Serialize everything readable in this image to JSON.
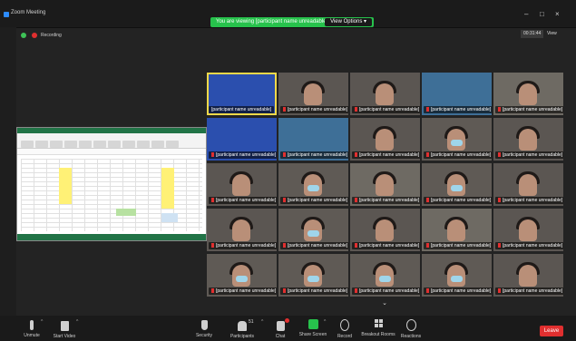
{
  "window": {
    "title": "Zoom Meeting",
    "controls": {
      "minimize": "–",
      "maximize": "□",
      "close": "×"
    }
  },
  "banner": {
    "text": "You are viewing [participant name unreadable]'s screen",
    "view_options": "View Options ▾",
    "color": "#27c24c"
  },
  "top": {
    "recording_label": "Recording",
    "timer": "00:31:44",
    "view_label": "View"
  },
  "shared_screen": {
    "app": "spreadsheet"
  },
  "participants": [
    {
      "name": "[participant name unreadable]",
      "muted": false,
      "active": true,
      "kind": "slide"
    },
    {
      "name": "[participant name unreadable]",
      "muted": true,
      "kind": "person"
    },
    {
      "name": "[participant name unreadable]",
      "muted": true,
      "kind": "person"
    },
    {
      "name": "[participant name unreadable]",
      "muted": true,
      "kind": "scenery"
    },
    {
      "name": "[participant name unreadable]",
      "muted": true,
      "kind": "room"
    },
    {
      "name": "[participant name unreadable]",
      "muted": true,
      "kind": "slide"
    },
    {
      "name": "[participant name unreadable]",
      "muted": true,
      "kind": "scenery"
    },
    {
      "name": "[participant name unreadable]",
      "muted": true,
      "kind": "person"
    },
    {
      "name": "[participant name unreadable]",
      "muted": true,
      "kind": "person-mask"
    },
    {
      "name": "[participant name unreadable]",
      "muted": true,
      "kind": "person"
    },
    {
      "name": "[participant name unreadable]",
      "muted": true,
      "kind": "person"
    },
    {
      "name": "[participant name unreadable]",
      "muted": true,
      "kind": "person-mask"
    },
    {
      "name": "[participant name unreadable]",
      "muted": true,
      "kind": "room"
    },
    {
      "name": "[participant name unreadable]",
      "muted": true,
      "kind": "person-mask"
    },
    {
      "name": "[participant name unreadable]",
      "muted": true,
      "kind": "person"
    },
    {
      "name": "[participant name unreadable]",
      "muted": true,
      "kind": "person"
    },
    {
      "name": "[participant name unreadable]",
      "muted": true,
      "kind": "person-mask"
    },
    {
      "name": "[participant name unreadable]",
      "muted": true,
      "kind": "person"
    },
    {
      "name": "[participant name unreadable]",
      "muted": true,
      "kind": "room"
    },
    {
      "name": "[participant name unreadable]",
      "muted": true,
      "kind": "person"
    },
    {
      "name": "[participant name unreadable]",
      "muted": true,
      "kind": "person-mask"
    },
    {
      "name": "[participant name unreadable]",
      "muted": true,
      "kind": "person-mask"
    },
    {
      "name": "[participant name unreadable]",
      "muted": true,
      "kind": "person-mask"
    },
    {
      "name": "[participant name unreadable]",
      "muted": true,
      "kind": "person-mask"
    },
    {
      "name": "[participant name unreadable]",
      "muted": true,
      "kind": "person"
    }
  ],
  "toolbar": {
    "unmute": "Unmute",
    "start_video": "Start Video",
    "security": "Security",
    "participants": "Participants",
    "participants_count": "51",
    "chat": "Chat",
    "share_screen": "Share Screen",
    "record": "Record",
    "breakout_rooms": "Breakout Rooms",
    "reactions": "Reactions",
    "leave": "Leave",
    "more_arrow": "⌄"
  },
  "colors": {
    "accent_green": "#27c24c",
    "leave_red": "#e02f2f",
    "active_speaker": "#f1d94a"
  }
}
